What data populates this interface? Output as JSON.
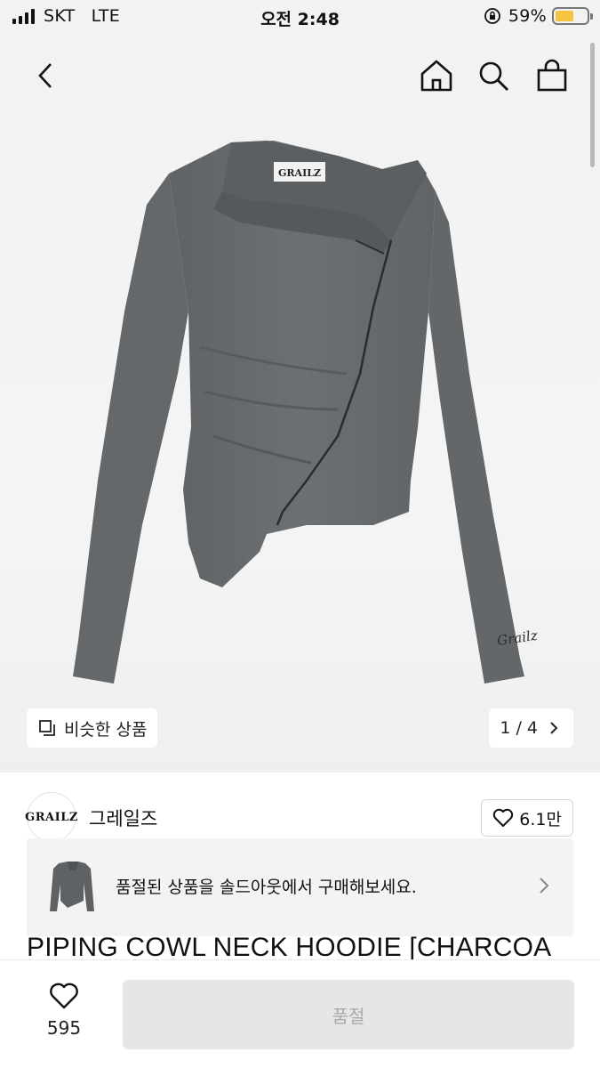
{
  "status_bar": {
    "carrier": "SKT",
    "network": "LTE",
    "time": "오전 2:48",
    "battery_percent": "59%",
    "battery_level": 0.59,
    "battery_color": "#f5c542"
  },
  "nav": {
    "back_icon": "chevron-left-icon",
    "home_icon": "home-icon",
    "search_icon": "search-icon",
    "cart_icon": "shopping-bag-icon"
  },
  "product_image": {
    "tag_text": "GRAILZ",
    "sleeve_text": "Grailz",
    "garment_color": "#676b6d"
  },
  "similar_button": {
    "label": "비슷한 상품",
    "icon": "similar-items-icon"
  },
  "pager": {
    "text": "1 / 4"
  },
  "seller": {
    "logo_text": "GRAILZ",
    "name": "그레일즈",
    "likes": "6.1만"
  },
  "soldout_banner": {
    "text": "품절된 상품을 솔드아웃에서 구매해보세요."
  },
  "product": {
    "title": "PIPING COWL NECK HOODIE [CHARCOA"
  },
  "bottom_bar": {
    "wish_count": "595",
    "buy_label": "품절"
  }
}
